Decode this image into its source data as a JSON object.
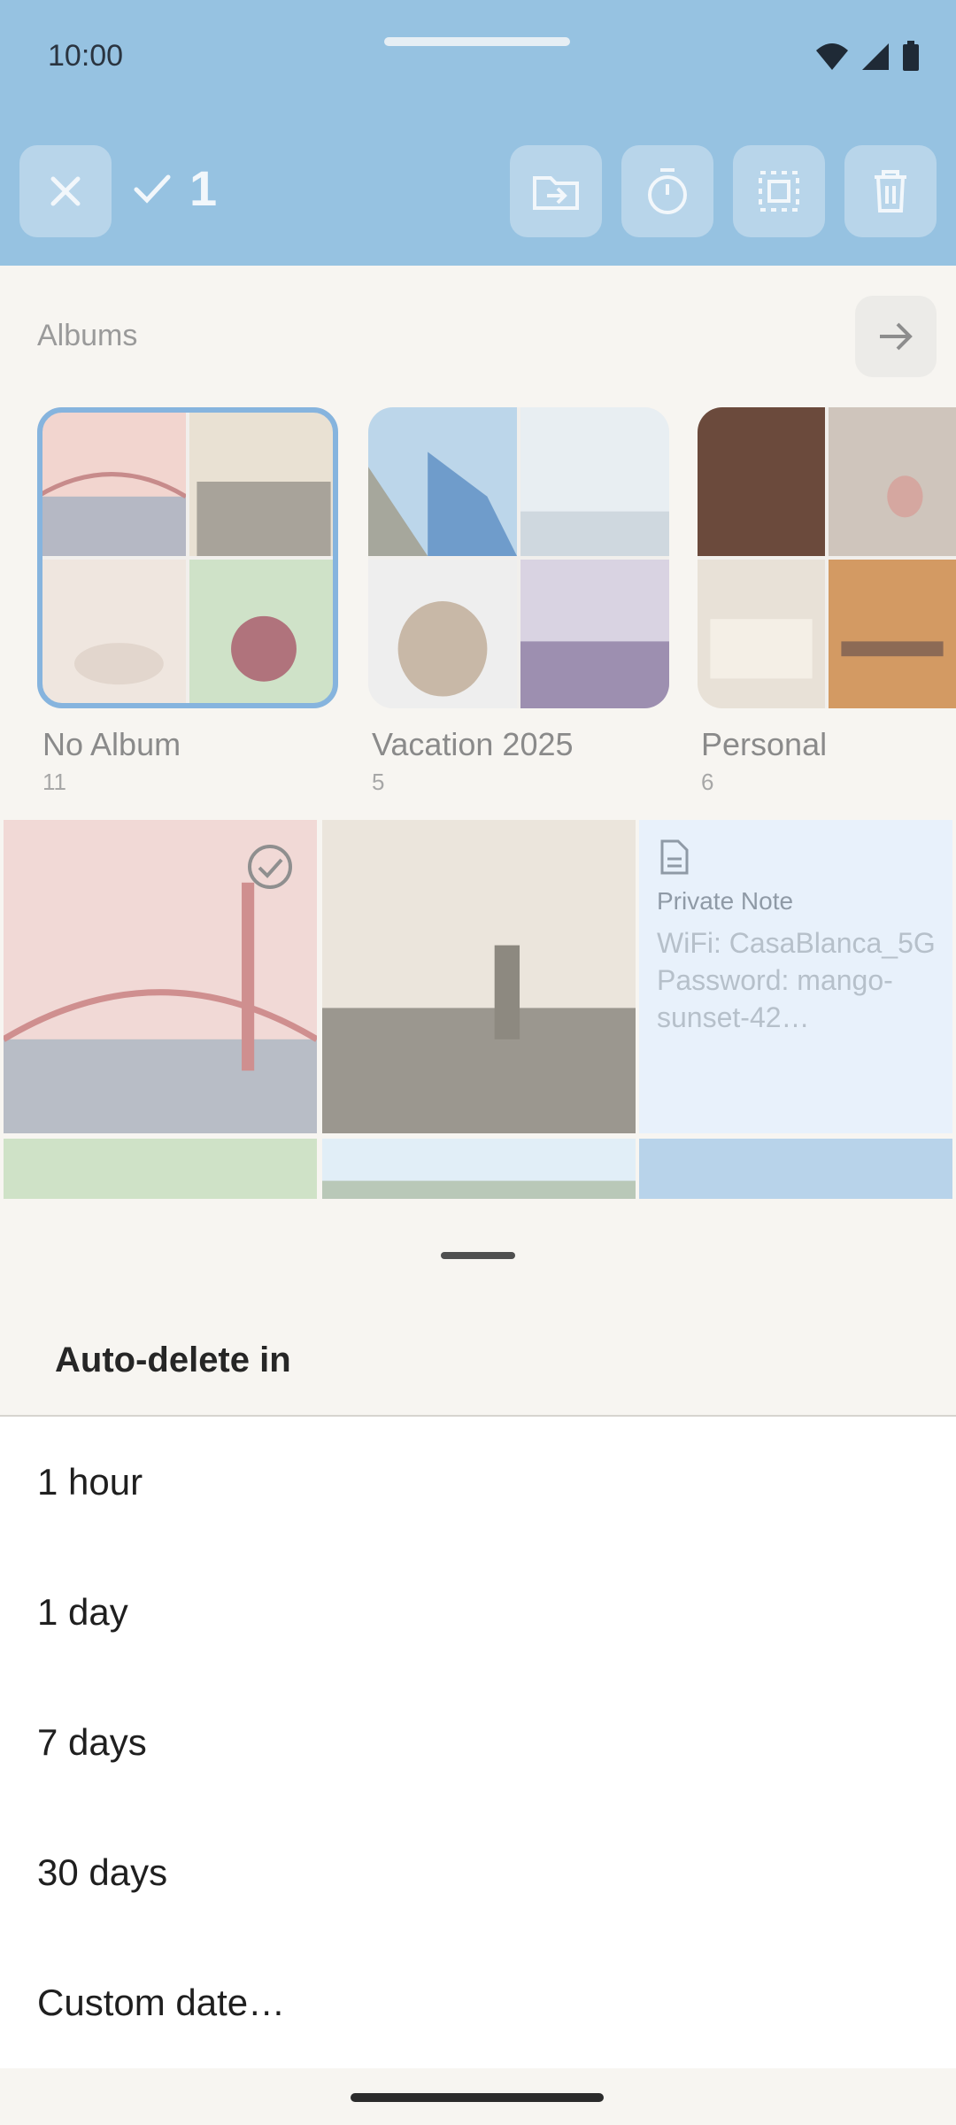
{
  "status": {
    "time": "10:00"
  },
  "selection_bar": {
    "count": "1"
  },
  "albums": {
    "header": "Albums",
    "items": [
      {
        "name": "No Album",
        "count": "11"
      },
      {
        "name": "Vacation 2025",
        "count": "5"
      },
      {
        "name": "Personal",
        "count": "6"
      }
    ]
  },
  "note": {
    "title": "Private Note",
    "body": "WiFi: CasaBlanca_5G Password: mango-sunset-42…"
  },
  "sheet": {
    "title": "Auto-delete in",
    "options": [
      "1 hour",
      "1 day",
      "7 days",
      "30 days",
      "Custom date…"
    ]
  },
  "colors": {
    "topbar": "#96c2e1",
    "selected_outline": "#86b4de",
    "sheet_bg": "#f7f5f1"
  }
}
